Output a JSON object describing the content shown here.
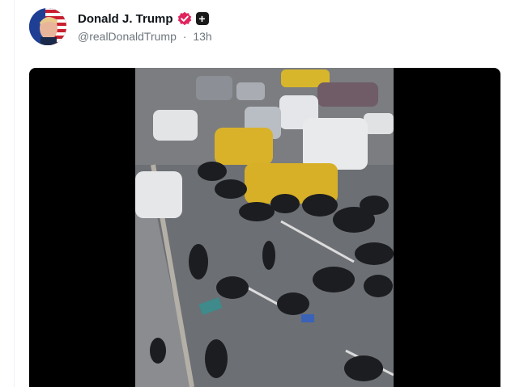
{
  "post": {
    "author": {
      "display_name": "Donald J. Trump",
      "handle": "@realDonaldTrump",
      "verified": true,
      "badge_icon": "plus-icon"
    },
    "separator": "·",
    "timestamp": "13h",
    "media": {
      "type": "video",
      "description_icon": "video-frame"
    }
  },
  "colors": {
    "verified_badge": "#e0245e",
    "handle_text": "#6e767d",
    "name_text": "#0f1419",
    "media_bg": "#000000"
  }
}
